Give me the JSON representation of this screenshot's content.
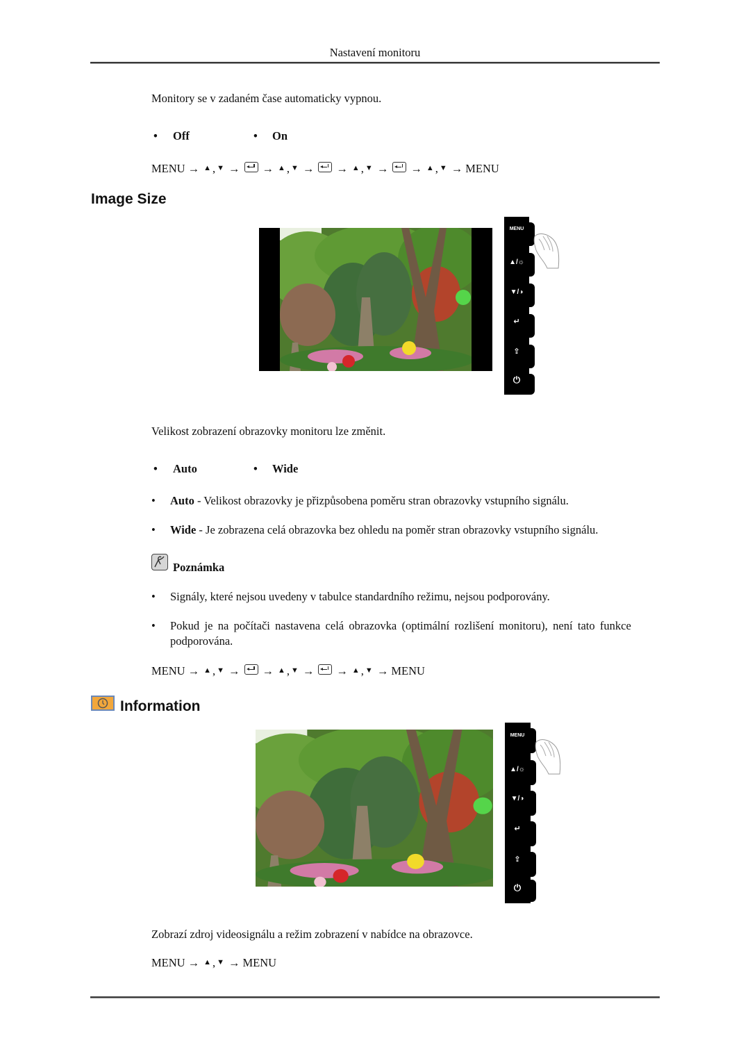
{
  "header": {
    "title": "Nastavení monitoru"
  },
  "auto_off_section": {
    "description": "Monitory se v zadaném čase automaticky vypnou.",
    "options": [
      "Off",
      "On"
    ],
    "menu_path": [
      "MENU",
      "→",
      "▲",
      ",",
      "▼",
      "→",
      "enter",
      "→",
      "▲",
      ",",
      "▼",
      "→",
      "enter",
      "→",
      "▲",
      ",",
      "▼",
      "→",
      "enter",
      "→",
      "▲",
      ",",
      "▼",
      "→",
      "MENU"
    ]
  },
  "image_size_section": {
    "title": "Image Size",
    "image_alt": "Garden scene with stone pagoda, trees and colored lanterns (letterboxed)",
    "description": "Velikost zobrazení obrazovky monitoru lze změnit.",
    "options": [
      "Auto",
      "Wide"
    ],
    "definitions": [
      {
        "term": "Auto",
        "text": " - Velikost obrazovky je přizpůsobena poměru stran obrazovky vstupního signálu."
      },
      {
        "term": "Wide",
        "text": " - Je zobrazena celá obrazovka bez ohledu na poměr stran obrazovky vstupního signálu."
      }
    ],
    "note": {
      "title": "Poznámka",
      "items": [
        "Signály, které nejsou uvedeny v tabulce standardního režimu, nejsou podporovány.",
        "Pokud je na počítači nastavena celá obrazovka (optimální rozlišení monitoru), není tato funkce",
        "podporována."
      ]
    },
    "menu_path": [
      "MENU",
      "→",
      "▲",
      ",",
      "▼",
      "→",
      "enter",
      "→",
      "▲",
      ",",
      "▼",
      "→",
      "enter",
      "→",
      "▲",
      ",",
      "▼",
      "→",
      "MENU"
    ]
  },
  "information_section": {
    "title": "Information",
    "image_alt": "Garden scene with stone pagoda, trees and colored lanterns (full width)",
    "description": "Zobrazí zdroj videosignálu a režim zobrazení v nabídce na obrazovce.",
    "menu_path": [
      "MENU",
      "→",
      "▲",
      ",",
      "▼",
      "→",
      "MENU"
    ]
  },
  "button_panel": {
    "buttons": [
      {
        "label": "MENU",
        "icon": "menu-icon"
      },
      {
        "label": "▲/☼",
        "icon": "up-brightness-icon"
      },
      {
        "label": "▼/◑",
        "icon": "down-contrast-icon"
      },
      {
        "label": "↵",
        "icon": "enter-icon"
      },
      {
        "label": "⇪",
        "icon": "source-icon"
      },
      {
        "label": "⏻",
        "icon": "power-icon"
      }
    ]
  },
  "colors": {
    "info_icon_bg": "#f2a73b",
    "info_icon_border": "#6a88b8"
  }
}
